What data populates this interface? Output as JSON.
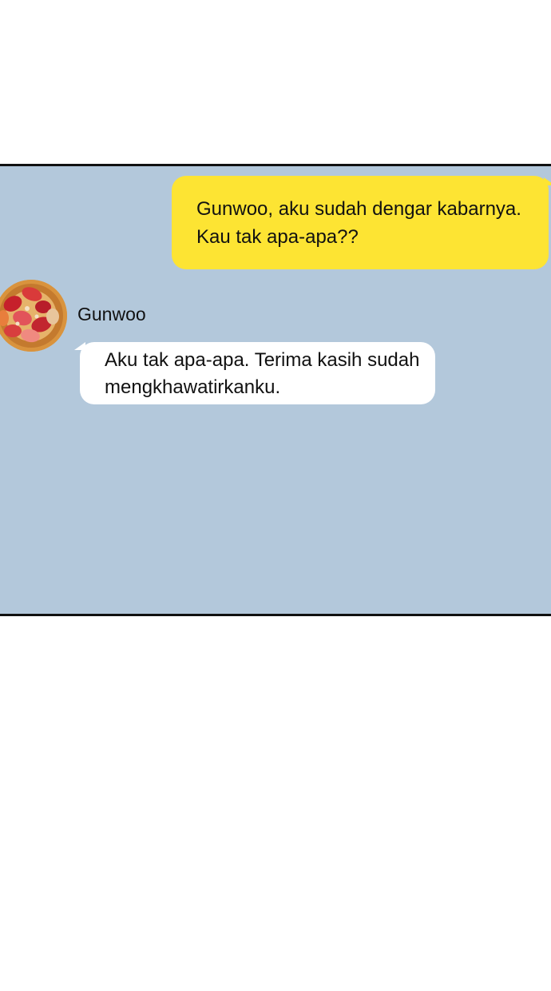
{
  "chat": {
    "background_color": "#b3c8db",
    "outgoing": {
      "lines": [
        "Gunwoo, aku sudah dengar kabarnya.",
        "Kau tak apa-apa??"
      ],
      "bubble_color": "#fde433"
    },
    "incoming": {
      "sender_name": "Gunwoo",
      "avatar_icon": "strawberry-cake-avatar-icon",
      "lines": [
        "Aku tak apa-apa. Terima kasih sudah",
        "mengkhawatirkanku."
      ],
      "bubble_color": "#ffffff"
    }
  }
}
